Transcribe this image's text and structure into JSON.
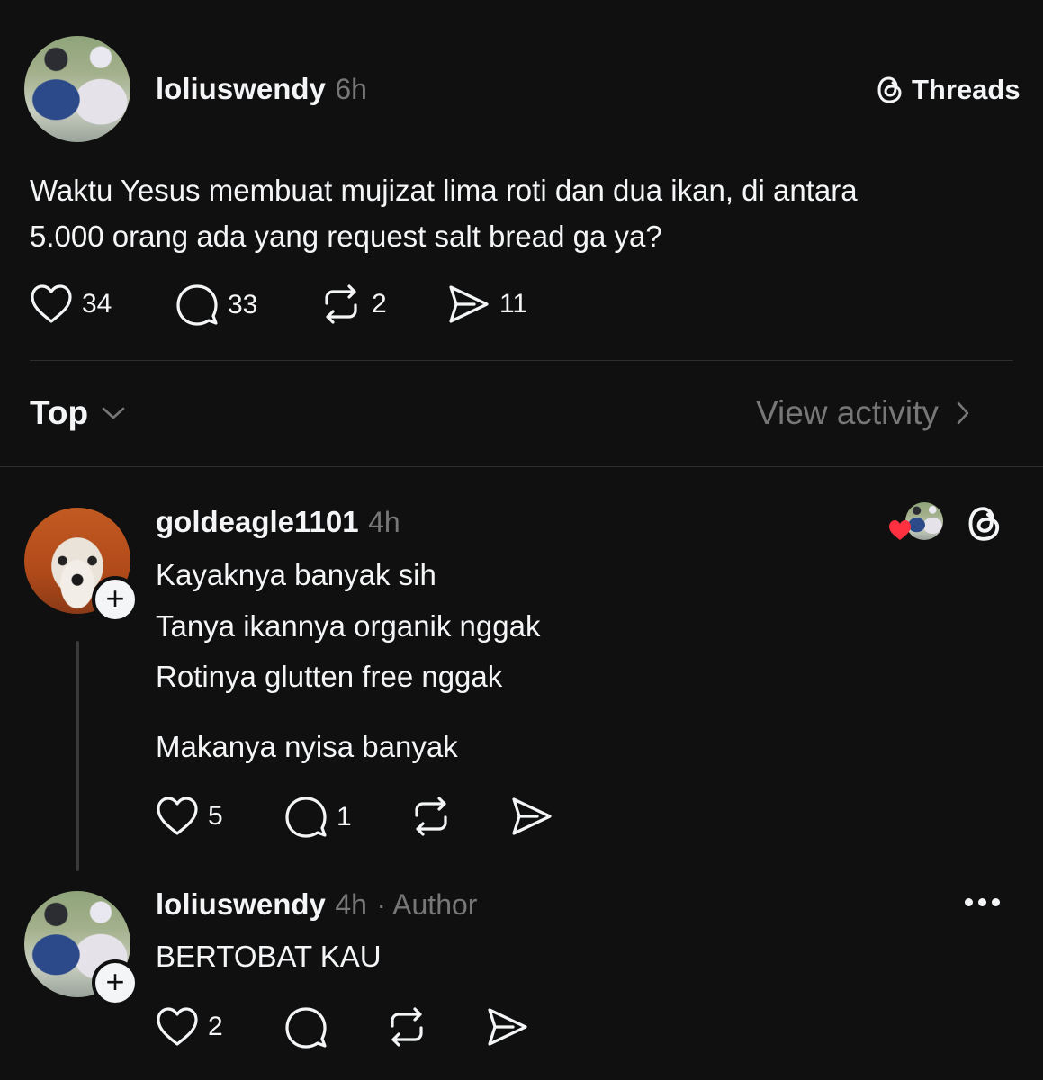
{
  "post": {
    "username": "loliuswendy",
    "time": "6h",
    "brand": "Threads",
    "text_line1": "Waktu Yesus membuat mujizat lima roti dan dua ikan, di antara",
    "text_line2": "5.000 orang ada yang request salt bread ga ya?",
    "likes": "34",
    "replies": "33",
    "reposts": "2",
    "shares": "11"
  },
  "filter": {
    "sort_label": "Top",
    "view_activity": "View activity"
  },
  "replies": [
    {
      "username": "goldeagle1101",
      "time": "4h",
      "lines": [
        "Kayaknya banyak sih",
        "Tanya ikannya organik nggak",
        "Rotinya glutten free nggak",
        "Makanya nyisa banyak"
      ],
      "likes": "5",
      "replies": "1"
    },
    {
      "username": "loliuswendy",
      "time": "4h",
      "author_tag": "· Author",
      "lines": [
        "BERTOBAT KAU"
      ],
      "likes": "2"
    }
  ],
  "colors": {
    "background": "#101010",
    "text": "#f3f5f7",
    "muted": "#777777",
    "heart_red": "#ff3040"
  },
  "icons": [
    "threads-logo-icon",
    "heart-icon",
    "comment-icon",
    "repost-icon",
    "share-icon",
    "chevron-down-icon",
    "chevron-right-icon",
    "plus-icon",
    "more-icon"
  ]
}
